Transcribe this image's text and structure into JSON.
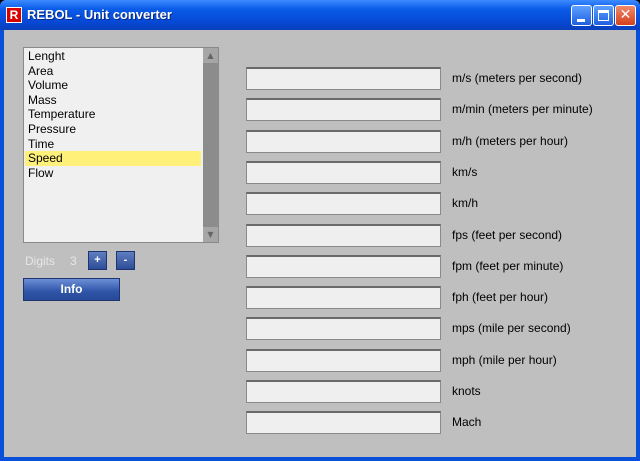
{
  "window": {
    "icon_letter": "R",
    "title": "REBOL - Unit converter"
  },
  "categories": {
    "items": [
      "Lenght",
      "Area",
      "Volume",
      "Mass",
      "Temperature",
      "Pressure",
      "Time",
      "Speed",
      "Flow"
    ],
    "selected": "Speed"
  },
  "controls": {
    "digits_label": "Digits",
    "digits_value": "3",
    "plus_label": "+",
    "minus_label": "-",
    "info_label": "Info"
  },
  "units": [
    {
      "label": "m/s (meters per second)",
      "value": ""
    },
    {
      "label": "m/min (meters per minute)",
      "value": ""
    },
    {
      "label": "m/h (meters per hour)",
      "value": ""
    },
    {
      "label": "km/s",
      "value": ""
    },
    {
      "label": "km/h",
      "value": ""
    },
    {
      "label": "fps (feet per second)",
      "value": ""
    },
    {
      "label": "fpm (feet per minute)",
      "value": ""
    },
    {
      "label": "fph (feet per hour)",
      "value": ""
    },
    {
      "label": "mps (mile per second)",
      "value": ""
    },
    {
      "label": "mph (mile per hour)",
      "value": ""
    },
    {
      "label": "knots",
      "value": ""
    },
    {
      "label": "Mach",
      "value": ""
    }
  ]
}
